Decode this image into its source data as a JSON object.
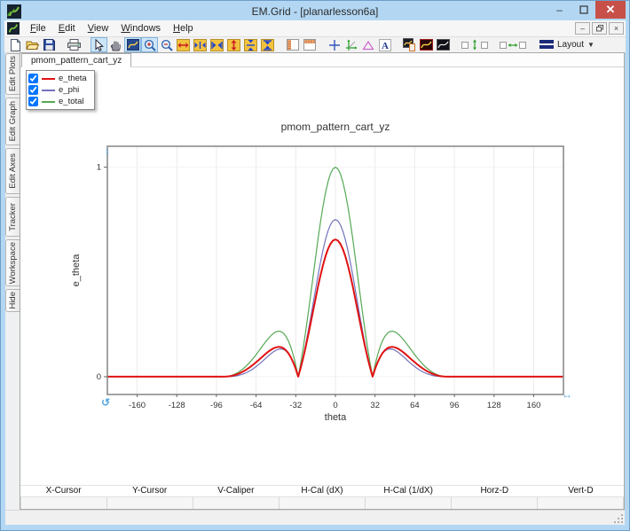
{
  "window": {
    "title": "EM.Grid - [planarlesson6a]",
    "controls": {
      "minimize": "–",
      "maximize": "",
      "close": "✕"
    }
  },
  "menu": {
    "items": [
      "File",
      "Edit",
      "View",
      "Windows",
      "Help"
    ]
  },
  "toolbar": {
    "layout_label": "Layout",
    "icons": [
      "new-file",
      "open-file",
      "save",
      "print",
      "select-cursor",
      "pan-hand",
      "zoom-region",
      "zoom-in",
      "zoom-out",
      "expand-x",
      "compress-x",
      "fit-x",
      "expand-y",
      "compress-y",
      "fit-y",
      "panel-left",
      "panel-top",
      "crosshair",
      "move-axes",
      "draw-triangle",
      "add-text",
      "copy-plot",
      "plot-style-red",
      "plot-style-dark",
      "space-vertical",
      "space-horizontal",
      "layout-menu"
    ]
  },
  "doc_tabs": [
    {
      "label": "pmom_pattern_cart_yz",
      "active": true
    }
  ],
  "sidebar": {
    "tabs": [
      "Edit Plots",
      "Edit Graph",
      "Edit Axes",
      "Tracker",
      "Workspace",
      "Hide"
    ]
  },
  "legend": {
    "items": [
      {
        "label": "e_theta",
        "color": "#e01212",
        "checked": true
      },
      {
        "label": "e_phi",
        "color": "#7373bd",
        "checked": true
      },
      {
        "label": "e_total",
        "color": "#55a855",
        "checked": true
      }
    ]
  },
  "chart_data": {
    "type": "line",
    "title": "pmom_pattern_cart_yz",
    "xlabel": "theta",
    "ylabel": "e_theta",
    "xlim": [
      -184,
      184
    ],
    "ylim": [
      -0.085,
      1.1
    ],
    "xticks": [
      -160,
      -128,
      -96,
      -64,
      -32,
      0,
      32,
      64,
      96,
      128,
      160
    ],
    "yticks": [
      0,
      1
    ],
    "grid": "vertical-light",
    "axis_color": "#8c8c8c",
    "grid_color": "#ebebeb",
    "tick_color": "#333333",
    "handles_color": "#58a7e0",
    "theta_step_deg": 2,
    "pattern_zero_beyond_deg": 90,
    "theta_abs_base": [
      1.0,
      0.992,
      0.9683,
      0.9297,
      0.8774,
      0.813,
      0.739,
      0.657,
      0.5699,
      0.48,
      0.3898,
      0.3012,
      0.2164,
      0.1371,
      0.0646,
      0,
      0.0561,
      0.1034,
      0.1419,
      0.1717,
      0.1935,
      0.208,
      0.2153,
      0.2172,
      0.214,
      0.2067,
      0.1962,
      0.1834,
      0.1688,
      0.1532,
      0.137,
      0.1209,
      0.1052,
      0.0901,
      0.0758,
      0.0627,
      0.0507,
      0.0399,
      0.0304,
      0.0223,
      0.0154,
      0.0098,
      0.0055,
      0.0025,
      0.0006,
      0
    ],
    "series": [
      {
        "name": "e_total",
        "color": "#55a855",
        "line_width": 1.2,
        "peak": 1.0,
        "cos_taper_pow": 0,
        "side_lobe_peak": 0.21,
        "first_null_deg": 30
      },
      {
        "name": "e_phi",
        "color": "#7373bd",
        "line_width": 1.2,
        "peak": 0.75,
        "cos_taper_pow": 0.6,
        "side_lobe_peak": 0.13,
        "first_null_deg": 30
      },
      {
        "name": "e_theta",
        "color": "#e01212",
        "line_width": 2,
        "peak": 0.655,
        "cos_taper_pow": 0,
        "side_lobe_peak": 0.14,
        "first_null_deg": 30
      }
    ]
  },
  "readout": {
    "headers": [
      "X-Cursor",
      "Y-Cursor",
      "V-Caliper",
      "H-Cal (dX)",
      "H-Cal (1/dX)",
      "Horz-D",
      "Vert-D"
    ],
    "values": [
      "",
      "",
      "",
      "",
      "",
      "",
      ""
    ]
  },
  "status": {
    "text": ""
  }
}
